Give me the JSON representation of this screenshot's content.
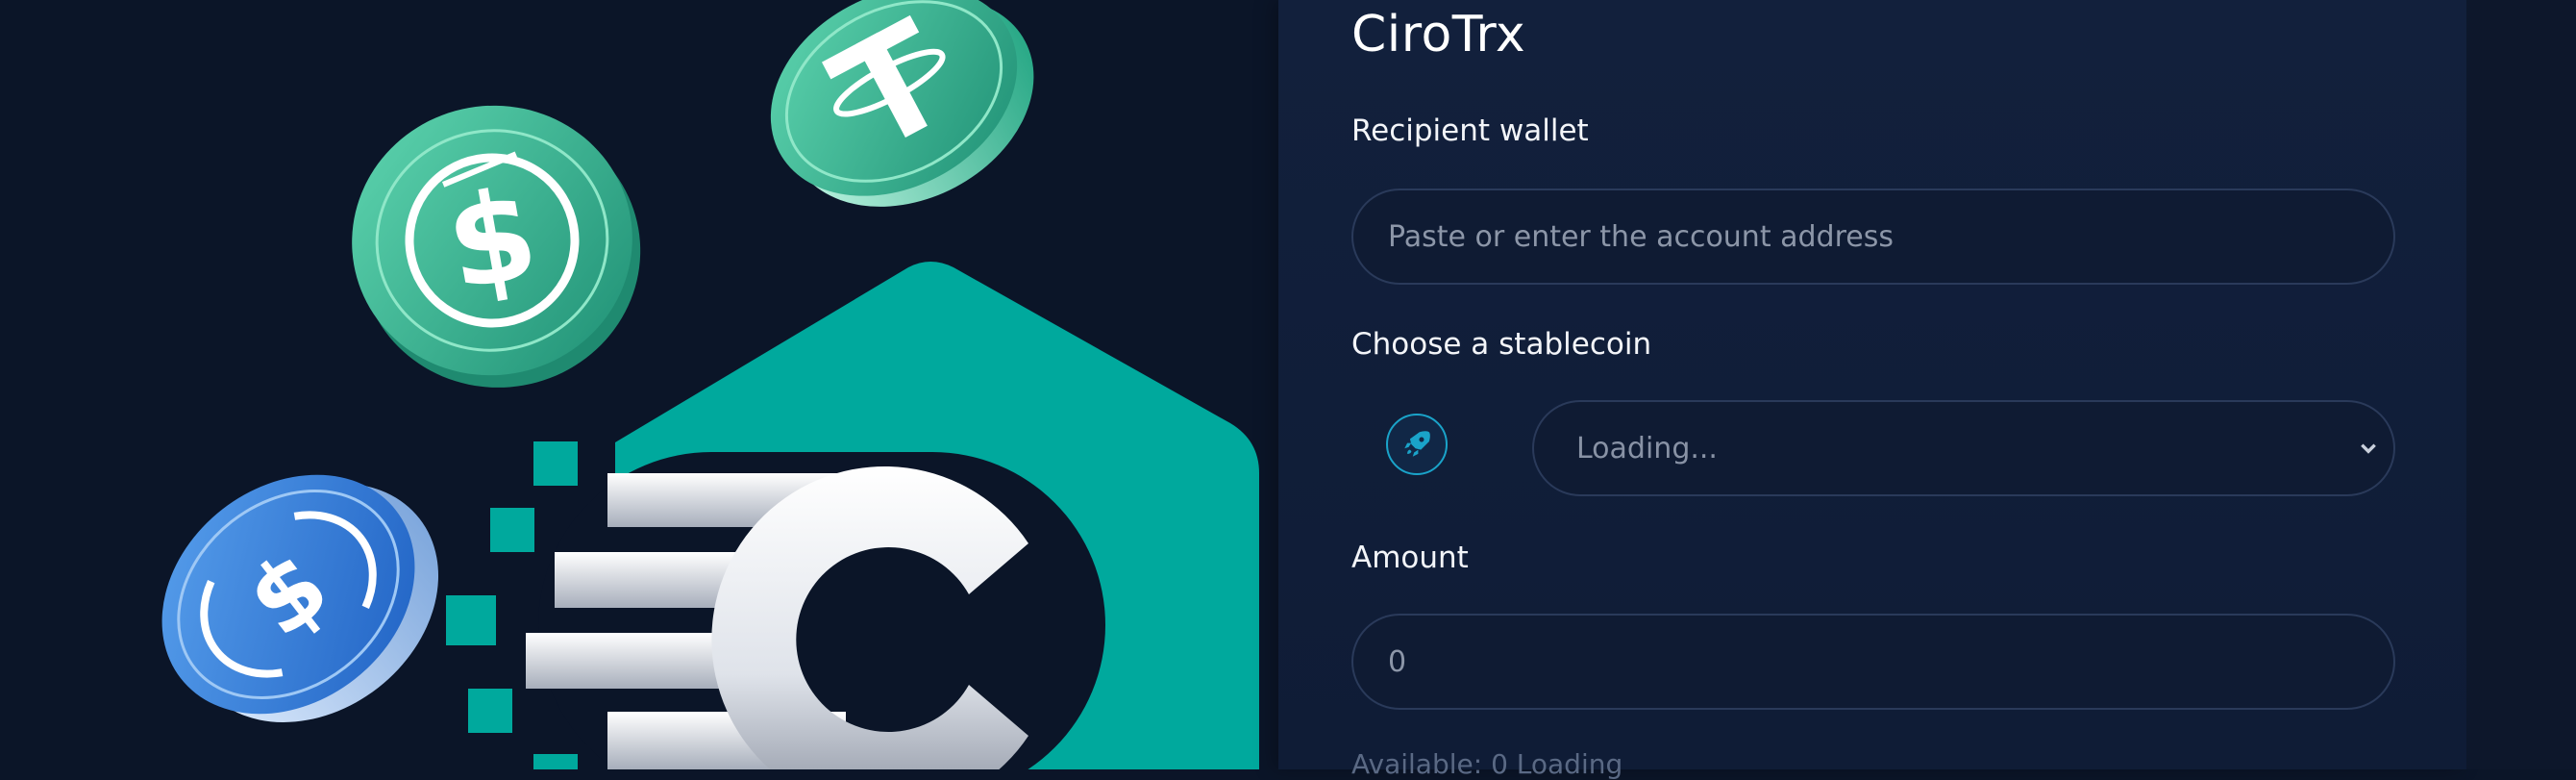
{
  "app": {
    "title": "CiroTrx"
  },
  "form": {
    "recipient": {
      "label": "Recipient wallet",
      "placeholder": "Paste or enter the account address",
      "value": ""
    },
    "stablecoin": {
      "label": "Choose a stablecoin",
      "selected": "Loading...",
      "icon": "rocket-icon"
    },
    "amount": {
      "label": "Amount",
      "placeholder": "0",
      "value": ""
    },
    "available": "Available: 0 Loading"
  },
  "colors": {
    "background": "#0b1528",
    "panel": "#12203c",
    "accent_teal": "#00a99d",
    "field_border": "#2a3a5a",
    "badge_ring": "#1aa3c9"
  },
  "hero": {
    "coins": [
      "tether-coin",
      "usd-stablecoin-coin",
      "usdc-coin"
    ],
    "logo": "ec-logo"
  }
}
